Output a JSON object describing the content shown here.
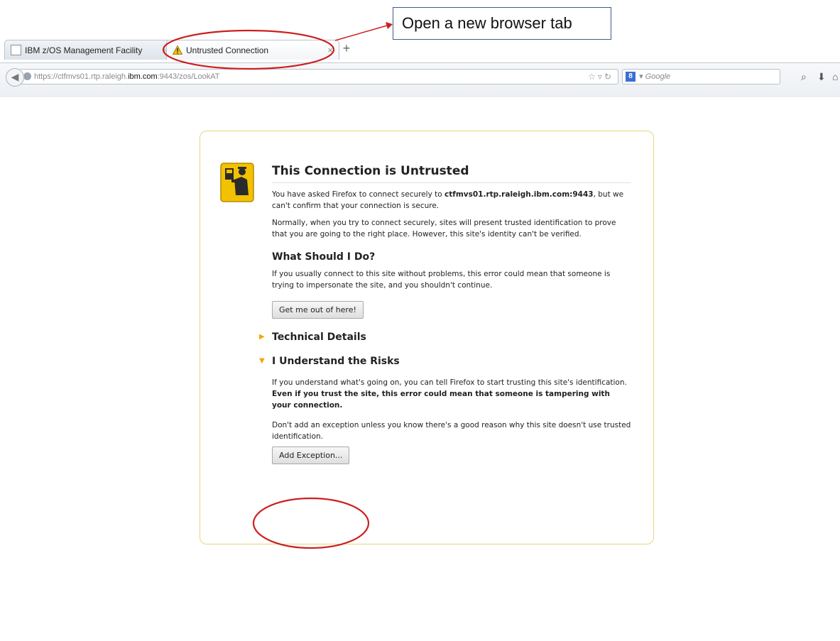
{
  "annotation": {
    "callout_text": "Open a new browser tab"
  },
  "tabs": [
    {
      "title": "IBM z/OS Management Facility",
      "close": "×"
    },
    {
      "title": "Untrusted Connection",
      "close": "×"
    }
  ],
  "new_tab_label": "+",
  "navbar": {
    "url_prefix": "https://ctfmvs01.rtp.raleigh.",
    "url_host": "ibm.com",
    "url_suffix": ":9443/zos/LookAT",
    "search_engine_badge": "8",
    "search_placeholder": "Google"
  },
  "error_page": {
    "title": "This Connection is Untrusted",
    "intro_before": "You have asked Firefox to connect securely to ",
    "intro_host": "ctfmvs01.rtp.raleigh.ibm.com:9443",
    "intro_after": ", but we can't confirm that your connection is secure.",
    "para2": "Normally, when you try to connect securely, sites will present trusted identification to prove that you are going to the right place. However, this site's identity can't be verified.",
    "what_heading": "What Should I Do?",
    "what_text": "If you usually connect to this site without problems, this error could mean that someone is trying to impersonate the site, and you shouldn't continue.",
    "get_out_button": "Get me out of here!",
    "technical_details": "Technical Details",
    "understand_risks": "I Understand the Risks",
    "risks_text_plain": "If you understand what's going on, you can tell Firefox to start trusting this site's identification. ",
    "risks_text_bold": "Even if you trust the site, this error could mean that someone is tampering with your connection.",
    "exception_text": "Don't add an exception unless you know there's a good reason why this site doesn't use trusted identification.",
    "add_exception_button": "Add Exception..."
  },
  "colors": {
    "annotation_red": "#cc1f1f",
    "callout_border": "#3d5d8a",
    "box_border": "#e8d67a",
    "expander_triangle": "#f2a900"
  }
}
